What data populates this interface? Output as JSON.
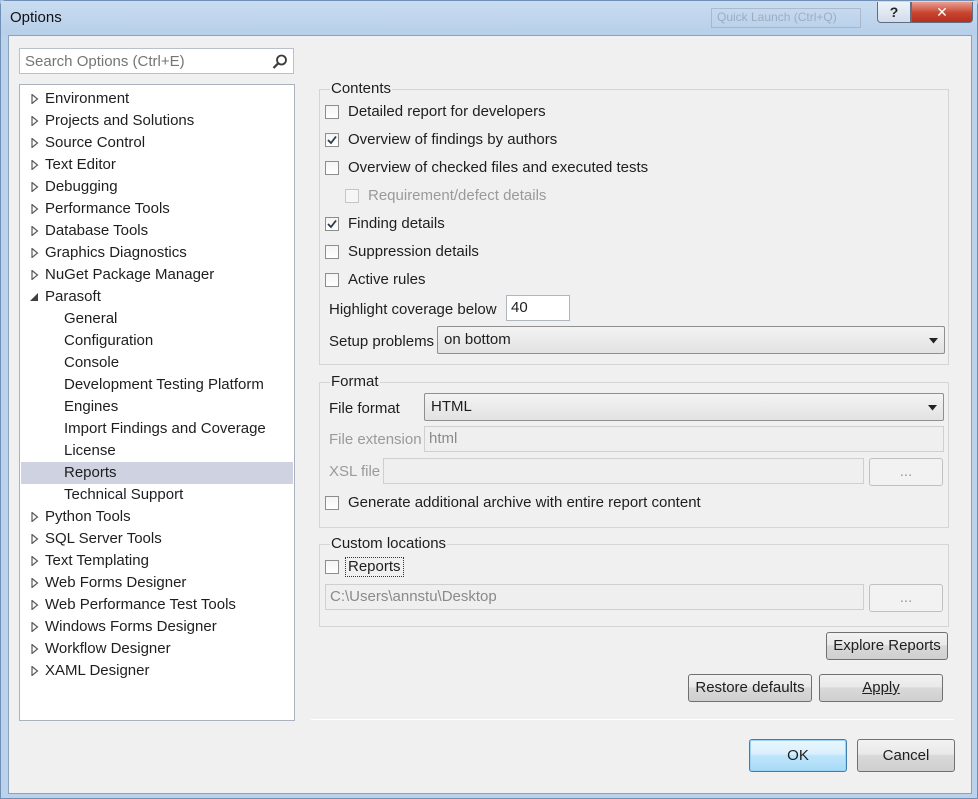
{
  "window": {
    "title": "Options",
    "quick_launch_placeholder": "Quick Launch (Ctrl+Q)",
    "help_label": "?",
    "close_label": "✕"
  },
  "search": {
    "placeholder": "Search Options (Ctrl+E)"
  },
  "tree": {
    "items": [
      {
        "label": "Environment",
        "expander": "collapsed"
      },
      {
        "label": "Projects and Solutions",
        "expander": "collapsed"
      },
      {
        "label": "Source Control",
        "expander": "collapsed"
      },
      {
        "label": "Text Editor",
        "expander": "collapsed"
      },
      {
        "label": "Debugging",
        "expander": "collapsed"
      },
      {
        "label": "Performance Tools",
        "expander": "collapsed"
      },
      {
        "label": "Database Tools",
        "expander": "collapsed"
      },
      {
        "label": "Graphics Diagnostics",
        "expander": "collapsed"
      },
      {
        "label": "NuGet Package Manager",
        "expander": "collapsed"
      },
      {
        "label": "Parasoft",
        "expander": "expanded"
      },
      {
        "label": "General",
        "child": true
      },
      {
        "label": "Configuration",
        "child": true
      },
      {
        "label": "Console",
        "child": true
      },
      {
        "label": "Development Testing Platform",
        "child": true
      },
      {
        "label": "Engines",
        "child": true
      },
      {
        "label": "Import Findings and Coverage",
        "child": true
      },
      {
        "label": "License",
        "child": true
      },
      {
        "label": "Reports",
        "child": true,
        "selected": true
      },
      {
        "label": "Technical Support",
        "child": true
      },
      {
        "label": "Python Tools",
        "expander": "collapsed"
      },
      {
        "label": "SQL Server Tools",
        "expander": "collapsed"
      },
      {
        "label": "Text Templating",
        "expander": "collapsed"
      },
      {
        "label": "Web Forms Designer",
        "expander": "collapsed"
      },
      {
        "label": "Web Performance Test Tools",
        "expander": "collapsed"
      },
      {
        "label": "Windows Forms Designer",
        "expander": "collapsed"
      },
      {
        "label": "Workflow Designer",
        "expander": "collapsed"
      },
      {
        "label": "XAML Designer",
        "expander": "collapsed"
      }
    ]
  },
  "contents": {
    "title": "Contents",
    "options": [
      {
        "label": "Detailed report for developers",
        "checked": false
      },
      {
        "label": "Overview of findings by authors",
        "checked": true
      },
      {
        "label": "Overview of checked files and executed tests",
        "checked": false
      },
      {
        "label": "Requirement/defect details",
        "checked": false,
        "disabled": true
      },
      {
        "label": "Finding details",
        "checked": true
      },
      {
        "label": "Suppression details",
        "checked": false
      },
      {
        "label": "Active rules",
        "checked": false
      }
    ],
    "highlight_label": "Highlight coverage below",
    "highlight_value": "40",
    "setup_label": "Setup problems",
    "setup_value": "on bottom"
  },
  "format": {
    "title": "Format",
    "file_format_label": "File format",
    "file_format_value": "HTML",
    "extension_label": "File extension",
    "extension_value": "html",
    "xsl_label": "XSL file",
    "xsl_value": "",
    "browse_label": "...",
    "archive_label": "Generate additional archive with entire report content",
    "archive_checked": false
  },
  "custom": {
    "title": "Custom locations",
    "reports_label": "Reports",
    "reports_checked": false,
    "path_value": "C:\\Users\\annstu\\Desktop",
    "browse_label": "..."
  },
  "buttons": {
    "explore": "Explore Reports",
    "restore": "Restore defaults",
    "apply": "Apply",
    "ok": "OK",
    "cancel": "Cancel"
  }
}
